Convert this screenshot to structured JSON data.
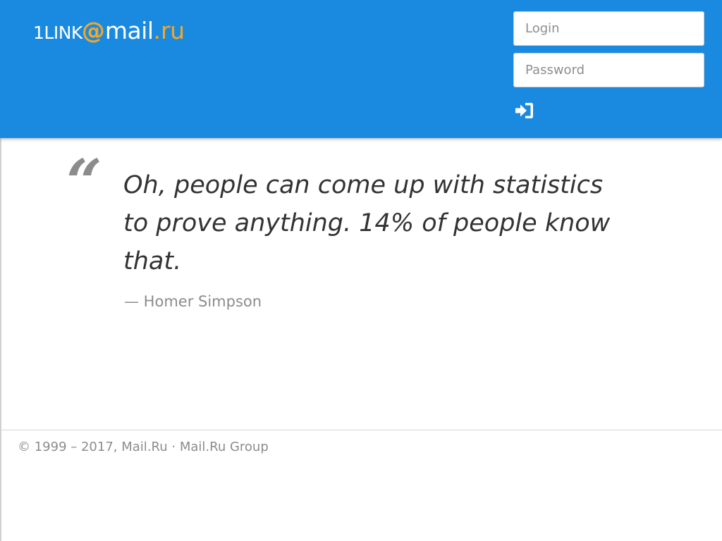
{
  "header": {
    "logo": {
      "prefix": "1LINK",
      "at": "@",
      "mail": "mail",
      "dot": ".",
      "ru": "ru"
    },
    "login": {
      "placeholder": "Login",
      "value": ""
    },
    "password": {
      "placeholder": "Password",
      "value": ""
    },
    "signin_icon": "sign-in-icon"
  },
  "quote": {
    "mark": "“",
    "text": "Oh, people can come up with statistics to prove anything. 14% of people know that.",
    "author": "— Homer Simpson"
  },
  "footer": {
    "copyright": "© 1999 – 2017,",
    "link_mailru": "Mail.Ru",
    "separator": "·",
    "link_group": "Mail.Ru Group"
  },
  "colors": {
    "header_background": "#1a8ae0",
    "logo_accent": "#f6a623",
    "quote_text": "#333333",
    "muted_text": "#8c8c8c"
  }
}
